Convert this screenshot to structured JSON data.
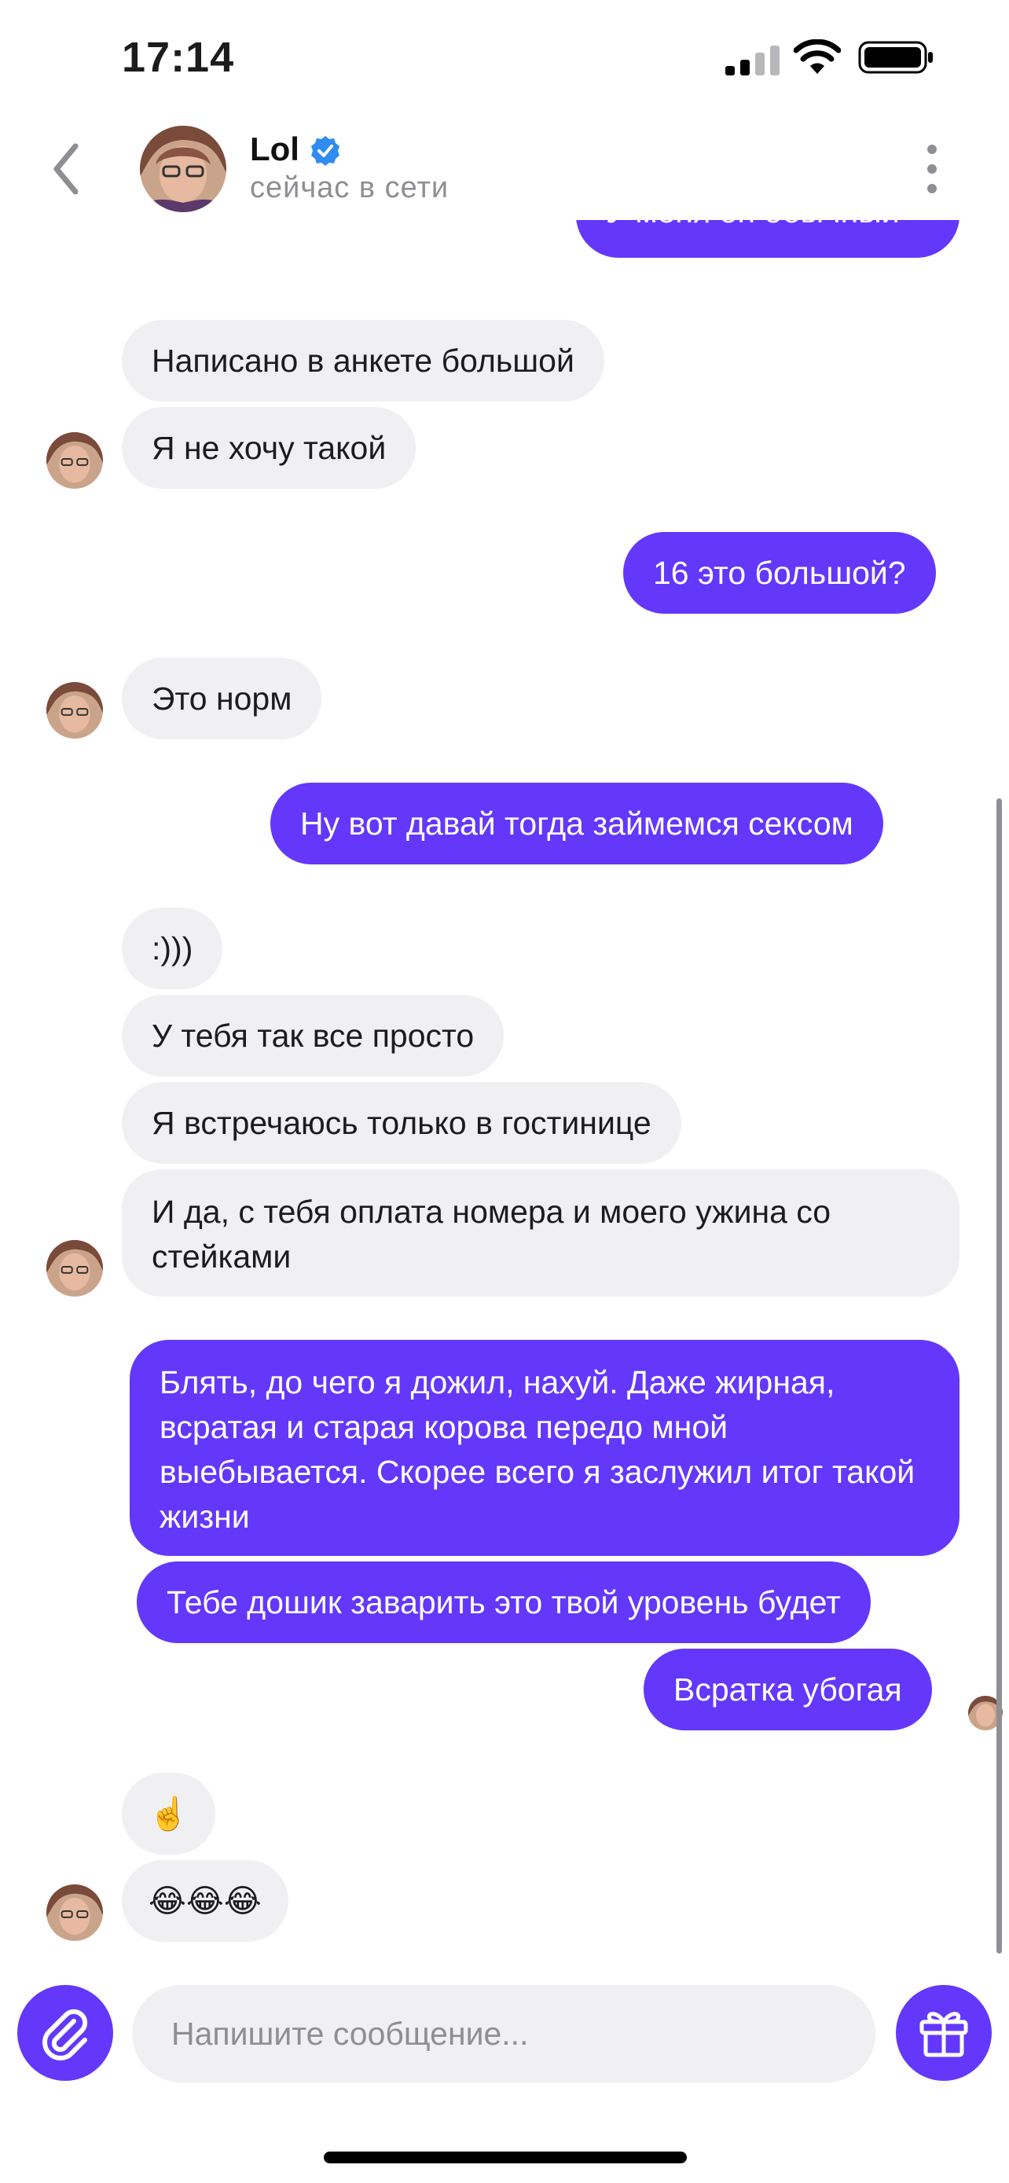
{
  "status_bar": {
    "time": "17:14"
  },
  "header": {
    "contact_name": "Lol",
    "contact_status": "сейчас в сети"
  },
  "messages": [
    {
      "dir": "out",
      "text": "У меня он обычный"
    },
    {
      "dir": "in",
      "text": "Написано в анкете большой"
    },
    {
      "dir": "in",
      "text": "Я не хочу такой"
    },
    {
      "dir": "out",
      "text": "16 это большой?"
    },
    {
      "dir": "in",
      "text": "Это норм"
    },
    {
      "dir": "out",
      "text": "Ну вот давай тогда займемся сексом"
    },
    {
      "dir": "in",
      "text": ":)))"
    },
    {
      "dir": "in",
      "text": "У тебя так все просто"
    },
    {
      "dir": "in",
      "text": "Я встречаюсь только в гостинице"
    },
    {
      "dir": "in",
      "text": "И да, с тебя оплата номера и моего ужина со стейками"
    },
    {
      "dir": "out",
      "text": "Блять, до чего я дожил, нахуй. Даже жирная, всратая и старая корова передо мной выебывается. Скорее всего я заслужил итог такой жизни"
    },
    {
      "dir": "out",
      "text": "Тебе дошик заварить это твой уровень будет"
    },
    {
      "dir": "out",
      "text": "Всратка убогая"
    },
    {
      "dir": "in",
      "text": "☝️"
    },
    {
      "dir": "in",
      "text": "😂😂😂"
    }
  ],
  "composer": {
    "placeholder": "Напишите сообщение..."
  },
  "icons": {
    "back": "chevron-left-icon",
    "verified": "verified-badge-icon",
    "more": "more-vertical-icon",
    "attach": "paperclip-icon",
    "gift": "gift-icon"
  },
  "colors": {
    "accent": "#6338fb",
    "incoming_bubble": "#f0f0f3",
    "verified": "#2f8cf0"
  }
}
